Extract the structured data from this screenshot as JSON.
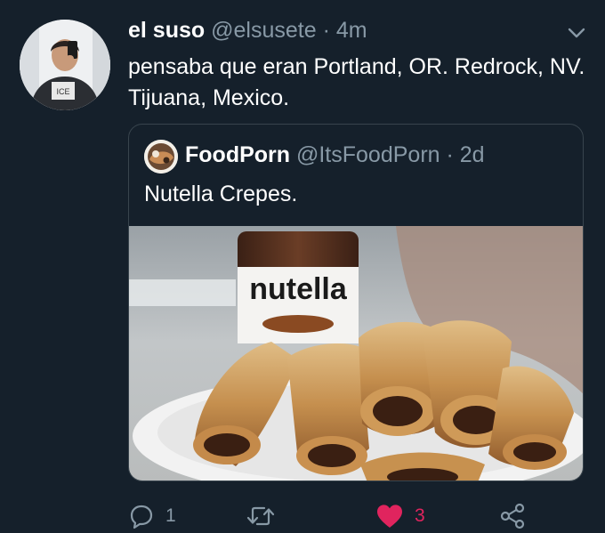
{
  "tweet": {
    "display_name": "el suso",
    "handle": "@elsusete",
    "separator": "·",
    "time": "4m",
    "text": "pensaba que eran Portland, OR. Redrock, NV. Tijuana, Mexico."
  },
  "quoted_tweet": {
    "display_name": "FoodPorn",
    "handle": "@ItsFoodPorn",
    "separator": "·",
    "time": "2d",
    "text": "Nutella Crepes.",
    "image_label": "nutella"
  },
  "actions": {
    "reply_count": "1",
    "retweet_count": "",
    "like_count": "3"
  },
  "colors": {
    "background": "#15202b",
    "muted_text": "#8899a6",
    "border": "#38444d",
    "like_pink": "#e0245e"
  },
  "icons": [
    "chevron-down-icon",
    "reply-icon",
    "retweet-icon",
    "heart-icon",
    "share-icon"
  ]
}
